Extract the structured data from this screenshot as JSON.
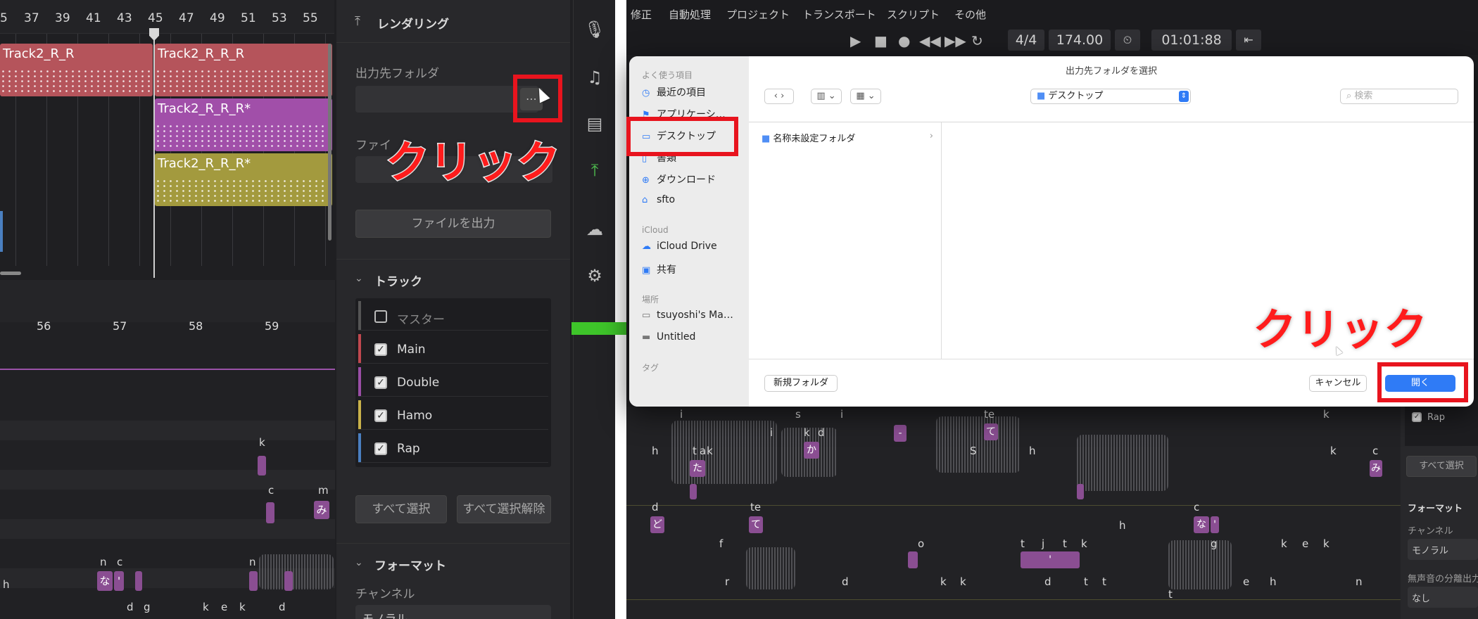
{
  "left": {
    "ruler_ticks": [
      "5",
      "37",
      "39",
      "41",
      "43",
      "45",
      "47",
      "49",
      "51",
      "53",
      "55"
    ],
    "clips": [
      {
        "name": "Track2_R_R",
        "color": "#b5545b"
      },
      {
        "name": "Track2_R_R_R",
        "color": "#b5545b"
      },
      {
        "name": "Track2_R_R_R*",
        "color": "#a14fa9"
      },
      {
        "name": "Track2_R_R_R*",
        "color": "#a39a3e"
      }
    ],
    "piano_ruler": [
      "56",
      "57",
      "58",
      "59"
    ],
    "piano_letters": [
      "k",
      "c",
      "m",
      "み",
      "n",
      "c",
      "な",
      "'",
      "d",
      "g",
      "k",
      "e",
      "k",
      "n",
      "d",
      "h"
    ],
    "render_panel": {
      "title": "レンダリング",
      "output_folder_label": "出力先フォルダ",
      "file_label": "ファイ",
      "export_button": "ファイルを出力",
      "track_section": "トラック",
      "tracks": [
        {
          "name": "マスター",
          "checked": false,
          "color": "#555555"
        },
        {
          "name": "Main",
          "checked": true,
          "color": "#c0484f"
        },
        {
          "name": "Double",
          "checked": true,
          "color": "#9a4ea6"
        },
        {
          "name": "Hamo",
          "checked": true,
          "color": "#c9b24a"
        },
        {
          "name": "Rap",
          "checked": true,
          "color": "#4a7fc0"
        }
      ],
      "select_all": "すべて選択",
      "deselect_all": "すべて選択解除",
      "format_section": "フォーマット",
      "channel_label": "チャンネル",
      "channel_value": "モノラル"
    },
    "icons": [
      "microphone-icon",
      "music-note-icon",
      "book-icon",
      "export-icon",
      "cloud-icon",
      "gear-icon"
    ],
    "annotation": "クリック"
  },
  "right": {
    "menu": [
      "修正",
      "自動処理",
      "プロジェクト",
      "トランスポート",
      "スクリプト",
      "その他"
    ],
    "transport": {
      "time_signature": "4/4",
      "tempo": "174.00",
      "position": "01:01:88"
    },
    "dialog": {
      "title": "出力先フォルダを選択",
      "sidebar": {
        "favorites_header": "よく使う項目",
        "favorites": [
          "最近の項目",
          "アプリケーシ…",
          "デスクトップ",
          "書類",
          "ダウンロード",
          "sfto"
        ],
        "icloud_header": "iCloud",
        "icloud": [
          "iCloud Drive",
          "共有"
        ],
        "locations_header": "場所",
        "locations": [
          "tsuyoshi's Ma…",
          "Untitled"
        ],
        "tags_header": "タグ"
      },
      "location": "デスクトップ",
      "search_placeholder": "検索",
      "items": [
        "名称未設定フォルダ"
      ],
      "new_folder": "新規フォルダ",
      "cancel": "キャンセル",
      "open": "開く"
    },
    "bg_letters": [
      "i",
      "s",
      "i",
      "te",
      "k",
      "h",
      "i",
      "k",
      "d",
      "-",
      "て",
      "S",
      "h",
      "t",
      "a",
      "k",
      "か",
      "た",
      "d",
      "te",
      "ど",
      "て",
      "h",
      "f",
      "o",
      "r",
      "k",
      "t",
      "h",
      "c",
      "な",
      "'",
      "k",
      "e",
      "k",
      "み",
      "c",
      "k",
      "t",
      "j",
      "t",
      "k",
      "'",
      "d",
      "g",
      "n",
      "d",
      "t",
      "k",
      "e",
      "t",
      "n"
    ],
    "side_panel": {
      "rap": "Rap",
      "select_all": "すべて選択",
      "format": "フォーマット",
      "channel_label": "チャンネル",
      "channel_value": "モノラル",
      "silence_label": "無声音の分離出力",
      "silence_value": "なし"
    },
    "annotation": "クリック"
  }
}
